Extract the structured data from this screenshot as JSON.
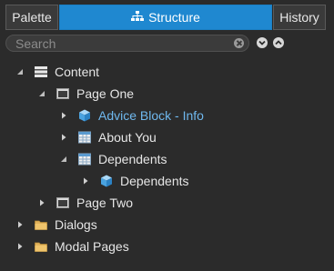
{
  "tabs": {
    "palette": "Palette",
    "structure": "Structure",
    "history": "History"
  },
  "search": {
    "placeholder": "Search",
    "value": ""
  },
  "tree": {
    "content": "Content",
    "page_one": "Page One",
    "advice_block": "Advice Block - Info",
    "about_you": "About You",
    "dependents_group": "Dependents",
    "dependents_child": "Dependents",
    "page_two": "Page Two",
    "dialogs": "Dialogs",
    "modal_pages": "Modal Pages"
  },
  "icons": {
    "structure_tab": "sitemap-icon",
    "content": "stack-icon",
    "page": "page-icon",
    "block": "cube-icon",
    "table": "table-icon",
    "folder": "folder-icon",
    "clear": "clear-search-icon",
    "expand_all": "expand-all-icon",
    "collapse_all": "collapse-all-icon"
  },
  "colors": {
    "active_tab": "#1f88d0",
    "selected_text": "#6fb8ee",
    "folder": "#e0b15a",
    "cube": "#6fb8ee"
  }
}
